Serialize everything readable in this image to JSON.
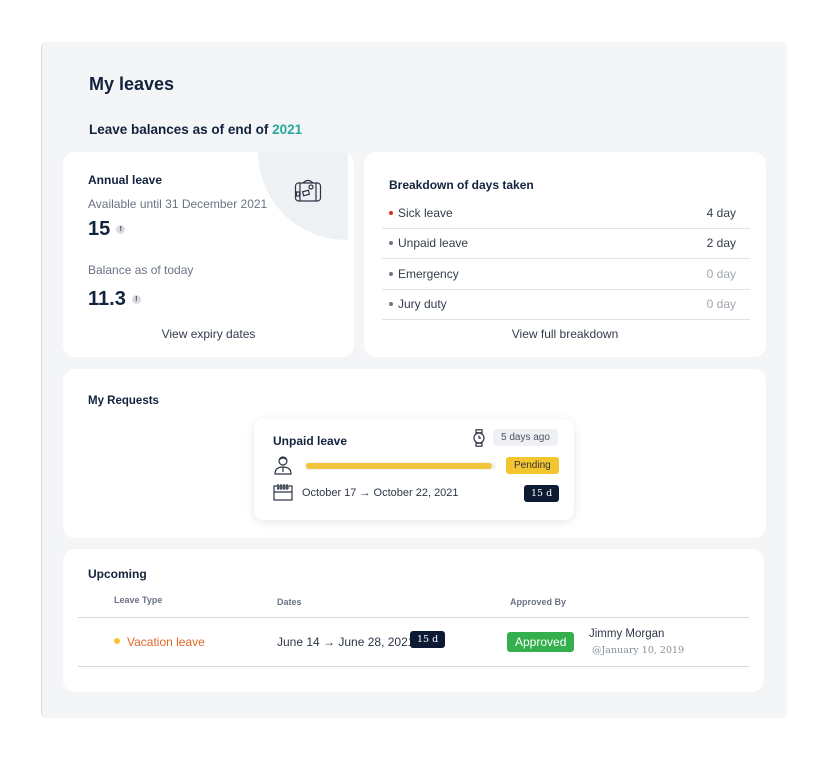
{
  "page": {
    "title": "My leaves",
    "subtitle_prefix": "Leave balances as of end of ",
    "subtitle_year": "2021"
  },
  "annual_leave": {
    "title": "Annual leave",
    "available_label": "Available until 31 December 2021",
    "available_value": "15",
    "balance_label": "Balance as of today",
    "balance_value": "11.3",
    "info_glyph": "!",
    "link": "View expiry dates",
    "icon": "suitcase-icon"
  },
  "breakdown": {
    "title": "Breakdown of days taken",
    "items": [
      {
        "label": "Sick leave",
        "value": "4 day",
        "dot_color": "#e02b20",
        "muted": false
      },
      {
        "label": "Unpaid leave",
        "value": "2 day",
        "dot_color": "#6b7482",
        "muted": false
      },
      {
        "label": "Emergency",
        "value": "0 day",
        "dot_color": "#6b7482",
        "muted": true
      },
      {
        "label": "Jury duty",
        "value": "0 day",
        "dot_color": "#6b7482",
        "muted": true
      }
    ],
    "link": "View full breakdown"
  },
  "requests": {
    "title": "My Requests",
    "card": {
      "leave_type": "Unpaid leave",
      "time_ago": "5 days ago",
      "status": "Pending",
      "progress": 1.0,
      "dates": "October   17 → October 22, 2021",
      "duration": "15 d"
    }
  },
  "upcoming": {
    "title": "Upcoming",
    "columns": [
      "Leave Type",
      "Dates",
      "Approved By"
    ],
    "rows": [
      {
        "leave_type": "Vacation leave",
        "dates": "June 14 → June 28, 2021",
        "duration": "15 d",
        "status": "Approved",
        "approver": "Jimmy Morgan",
        "approved_on": "@January 10,  2019"
      }
    ]
  },
  "colors": {
    "accent_teal": "#2aa79b",
    "pending_yellow": "#f3c62f",
    "approved_green": "#33b04d",
    "vacation_orange": "#e0662a",
    "navy": "#0d1a33",
    "sick_red": "#e02b20"
  }
}
